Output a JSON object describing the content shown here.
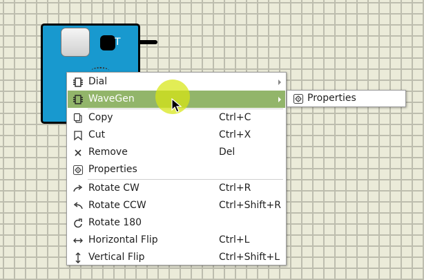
{
  "component": {
    "label": "T"
  },
  "context_menu": {
    "items": [
      {
        "label": "Dial",
        "shortcut": "",
        "icon": "chip-icon",
        "submenu": true
      },
      {
        "label": "WaveGen",
        "shortcut": "",
        "icon": "chip-icon",
        "submenu": true,
        "active": true
      },
      {
        "label": "Copy",
        "shortcut": "Ctrl+C",
        "icon": "copy-icon"
      },
      {
        "label": "Cut",
        "shortcut": "Ctrl+X",
        "icon": "cut-icon"
      },
      {
        "label": "Remove",
        "shortcut": "Del",
        "icon": "remove-icon"
      },
      {
        "label": "Properties",
        "shortcut": "",
        "icon": "properties-icon"
      },
      {
        "label": "Rotate CW",
        "shortcut": "Ctrl+R",
        "icon": "rotate-cw-icon"
      },
      {
        "label": "Rotate CCW",
        "shortcut": "Ctrl+Shift+R",
        "icon": "rotate-ccw-icon"
      },
      {
        "label": "Rotate 180",
        "shortcut": "",
        "icon": "rotate-180-icon"
      },
      {
        "label": "Horizontal Flip",
        "shortcut": "Ctrl+L",
        "icon": "horizontal-flip-icon"
      },
      {
        "label": "Vertical Flip",
        "shortcut": "Ctrl+Shift+L",
        "icon": "vertical-flip-icon"
      }
    ]
  },
  "submenu": {
    "items": [
      {
        "label": "Properties",
        "icon": "properties-icon"
      }
    ]
  },
  "colors": {
    "canvas": "#ebebd9",
    "grid": "#bdbdae",
    "component": "#1899cf",
    "menu_highlight": "#92b56a",
    "cursor_highlight": "#d7e614"
  }
}
